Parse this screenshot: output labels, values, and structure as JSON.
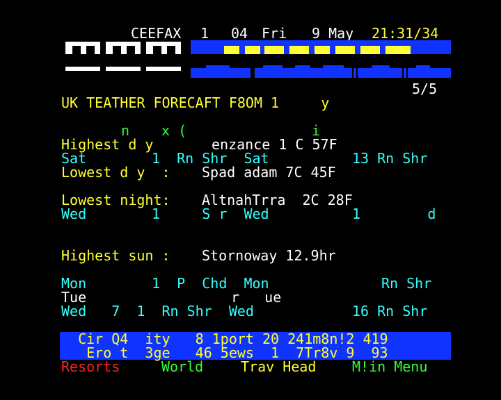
{
  "header": {
    "service": "CEEFAX",
    "page": "1",
    "channel": "04",
    "day": "Fri",
    "date": "9 May",
    "time": "21:31/34"
  },
  "subpage": "5/5",
  "title": "UK TEATHER FORECAFT F8OM 1     y",
  "rows": {
    "r1": {
      "a": "n",
      "b": "x (",
      "c": "i"
    },
    "highest_day": {
      "label": "Highest d y",
      "value": "enzance 1 C 57F"
    },
    "sat_line": {
      "left": "Sat",
      "mid": "1  Rn Shr  Sat",
      "right": "13 Rn Shr"
    },
    "lowest_day": {
      "label": "Lowest d y  :",
      "value": "Spad adam 7C 45F"
    },
    "lowest_night": {
      "label": "Lowest night:",
      "value": "AltnahTrra  2C 28F"
    },
    "wed_line1": {
      "left": "Wed",
      "mid": "1     S r  Wed",
      "right": "1        d"
    },
    "highest_sun": {
      "label": "Highest sun :",
      "value": "Stornoway 12.9hr"
    },
    "mon_line": {
      "left": "Mon",
      "mid": "1  P  Chd  Mon",
      "right": "Rn Shr"
    },
    "tue_line": {
      "left": "Tue",
      "mid": "r   ue"
    },
    "wed_line2": {
      "left": "Wed   7  1  Rn Shr  Wed",
      "right": "16 Rn Shr"
    }
  },
  "ticker": {
    "line1": "  Cir Q4  ity   8 1port 20 241m8n!2 419",
    "line2": "   Ero t  3ge   46 5ews  1  7Tr8v 9  93"
  },
  "fastext": {
    "red": "Resorts",
    "green": "World",
    "yellow": "Trav Head",
    "cyan": "M!in Menu"
  },
  "colors": {
    "background": "#000000",
    "white": "#ffffff",
    "yellow": "#ffff33",
    "cyan": "#33ffff",
    "green": "#33ff33",
    "red": "#ff2222",
    "blue": "#1133ff"
  }
}
